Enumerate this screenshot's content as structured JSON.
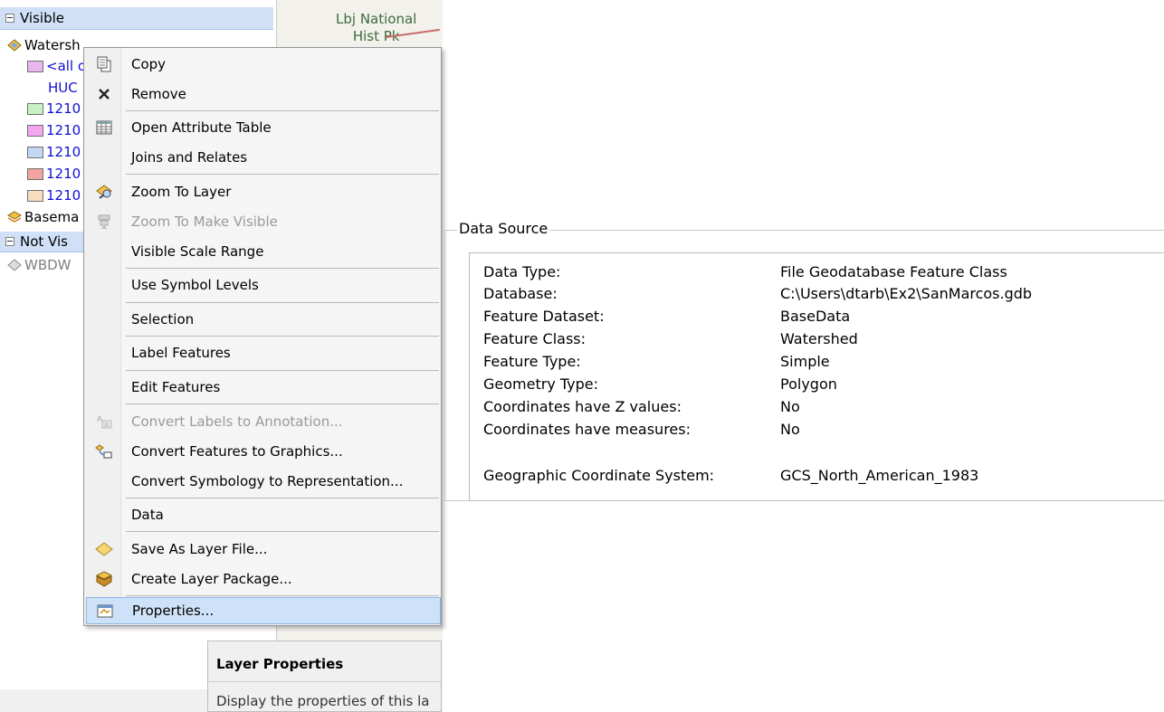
{
  "toc": {
    "visible_header": "Visible",
    "layer_watershed": "Watersh",
    "symbol_all": "<all o",
    "field_huc": "HUC",
    "classes": [
      {
        "label": "1210",
        "color": "#c9f2c4"
      },
      {
        "label": "1210",
        "color": "#f3a6ef"
      },
      {
        "label": "1210",
        "color": "#c3d7f2"
      },
      {
        "label": "1210",
        "color": "#f2a5a0"
      },
      {
        "label": "1210",
        "color": "#f7dcc0"
      }
    ],
    "all_color": "#e8b7ef",
    "layer_basemap": "Basema",
    "not_visible_header": "Not Vis",
    "layer_wbd": "WBDW"
  },
  "map": {
    "label_line1": "Lbj National",
    "label_line2": "Hist Pk"
  },
  "context_menu": {
    "items": [
      {
        "label": "Copy",
        "icon": "copy-icon",
        "enabled": true
      },
      {
        "label": "Remove",
        "icon": "remove-x-icon",
        "enabled": true
      },
      {
        "label": "Open Attribute Table",
        "icon": "table-icon",
        "enabled": true
      },
      {
        "label": "Joins and Relates",
        "icon": "",
        "enabled": true
      },
      {
        "label": "Zoom To Layer",
        "icon": "zoom-to-layer-icon",
        "enabled": true
      },
      {
        "label": "Zoom To Make Visible",
        "icon": "zoom-visible-icon",
        "enabled": false
      },
      {
        "label": "Visible Scale Range",
        "icon": "",
        "enabled": true
      },
      {
        "label": "Use Symbol Levels",
        "icon": "",
        "enabled": true
      },
      {
        "label": "Selection",
        "icon": "",
        "enabled": true
      },
      {
        "label": "Label Features",
        "icon": "",
        "enabled": true
      },
      {
        "label": "Edit Features",
        "icon": "",
        "enabled": true
      },
      {
        "label": "Convert Labels to Annotation...",
        "icon": "convert-labels-icon",
        "enabled": false
      },
      {
        "label": "Convert Features to Graphics...",
        "icon": "convert-graphics-icon",
        "enabled": true
      },
      {
        "label": "Convert Symbology to Representation...",
        "icon": "",
        "enabled": true
      },
      {
        "label": "Data",
        "icon": "",
        "enabled": true
      },
      {
        "label": "Save As Layer File...",
        "icon": "layer-file-icon",
        "enabled": true
      },
      {
        "label": "Create Layer Package...",
        "icon": "layer-package-icon",
        "enabled": true
      },
      {
        "label": "Properties...",
        "icon": "properties-icon",
        "enabled": true,
        "highlighted": true
      }
    ]
  },
  "tooltip": {
    "title": "Layer Properties",
    "description": "Display the properties of this la"
  },
  "data_source": {
    "title": "Data Source",
    "rows": [
      {
        "key": "Data Type:",
        "value": "File Geodatabase Feature Class"
      },
      {
        "key": "Database:",
        "value": "C:\\Users\\dtarb\\Ex2\\SanMarcos.gdb"
      },
      {
        "key": "Feature Dataset:",
        "value": "BaseData"
      },
      {
        "key": "Feature Class:",
        "value": "Watershed"
      },
      {
        "key": "Feature Type:",
        "value": "Simple"
      },
      {
        "key": "Geometry Type:",
        "value": "Polygon"
      },
      {
        "key": "Coordinates have Z values:",
        "value": "No"
      },
      {
        "key": "Coordinates have measures:",
        "value": "No"
      },
      {
        "key": "Geographic Coordinate System:",
        "value": "GCS_North_American_1983"
      }
    ]
  }
}
